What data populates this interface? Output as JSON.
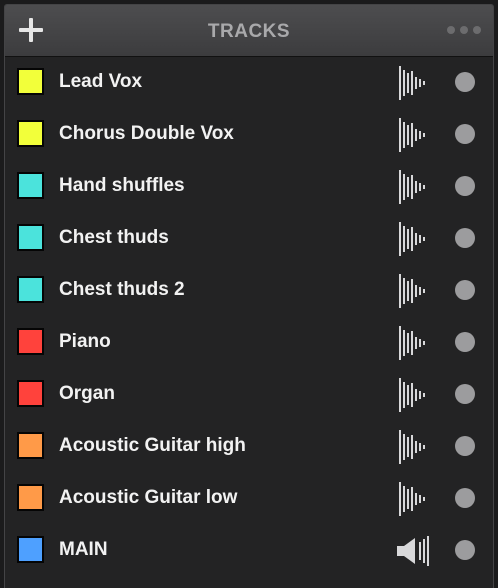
{
  "header": {
    "title": "TRACKS",
    "add_icon": "plus-icon",
    "more_icon": "ellipsis-icon"
  },
  "tracks": [
    {
      "name": "Lead Vox",
      "color": "#f2ff3a",
      "icon": "waveform-icon"
    },
    {
      "name": "Chorus Double Vox",
      "color": "#f2ff3a",
      "icon": "waveform-icon"
    },
    {
      "name": "Hand shuffles",
      "color": "#4be3dc",
      "icon": "waveform-icon"
    },
    {
      "name": "Chest thuds",
      "color": "#4be3dc",
      "icon": "waveform-icon"
    },
    {
      "name": "Chest thuds 2",
      "color": "#4be3dc",
      "icon": "waveform-icon"
    },
    {
      "name": "Piano",
      "color": "#ff423c",
      "icon": "waveform-icon"
    },
    {
      "name": "Organ",
      "color": "#ff423c",
      "icon": "waveform-icon"
    },
    {
      "name": "Acoustic Guitar high",
      "color": "#ff9a48",
      "icon": "waveform-icon"
    },
    {
      "name": "Acoustic Guitar low",
      "color": "#ff9a48",
      "icon": "waveform-icon"
    },
    {
      "name": "MAIN",
      "color": "#4ea0ff",
      "icon": "speaker-icon"
    }
  ]
}
